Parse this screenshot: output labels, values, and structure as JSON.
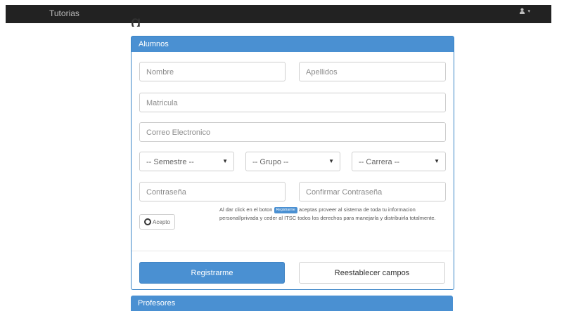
{
  "navbar": {
    "brand": "Tutorias",
    "user_caret": "▾"
  },
  "alumnos_panel": {
    "title": "Alumnos",
    "fields": {
      "nombre": "Nombre",
      "apellidos": "Apellidos",
      "matricula": "Matricula",
      "correo": "Correo Electronico",
      "contrasena": "Contraseña",
      "confirmar": "Confirmar Contraseña"
    },
    "selects": {
      "semestre": "-- Semestre --",
      "grupo": "-- Grupo --",
      "carrera": "-- Carrera --"
    },
    "accept_label": "Acepto",
    "terms": {
      "before": "Al dar click en el boton",
      "badge": "Registrarme",
      "after": "aceptas proveer al sistema de toda tu informacion personal/privada y ceder al ITSC todos los derechos para manejarla y distribuirla totalmente."
    },
    "register_button": "Registrarme",
    "reset_button": "Reestablecer campos"
  },
  "profesores_panel": {
    "title": "Profesores"
  },
  "colors": {
    "primary": "#4a90d2",
    "navbar": "#222222"
  }
}
